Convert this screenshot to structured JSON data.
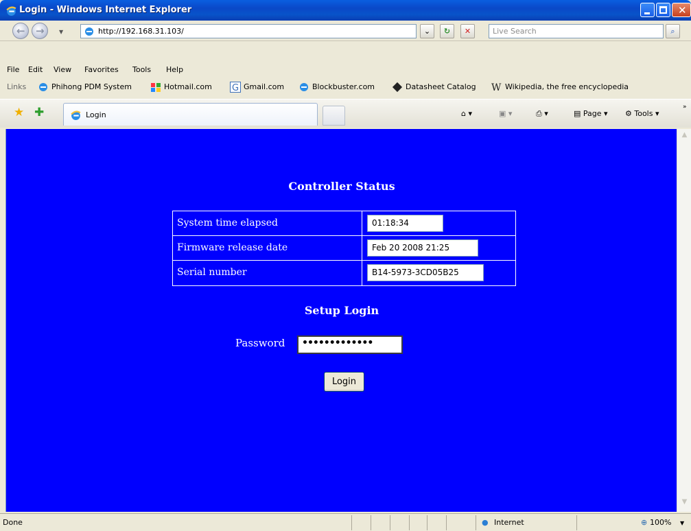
{
  "window": {
    "title": "Login - Windows Internet Explorer"
  },
  "address": {
    "url": "http://192.168.31.103/",
    "search_placeholder": "Live Search"
  },
  "menu": [
    "File",
    "Edit",
    "View",
    "Favorites",
    "Tools",
    "Help"
  ],
  "links_bar": {
    "label": "Links",
    "items": [
      "Phihong PDM System",
      "Hotmail.com",
      "Gmail.com",
      "Blockbuster.com",
      "Datasheet Catalog",
      "Wikipedia, the free encyclopedia"
    ]
  },
  "tab": {
    "title": "Login"
  },
  "commands": {
    "page": "Page",
    "tools": "Tools"
  },
  "page": {
    "status_heading": "Controller Status",
    "rows": [
      {
        "label": "System time elapsed",
        "value": "01:18:34"
      },
      {
        "label": "Firmware release date",
        "value": "Feb 20 2008 21:25"
      },
      {
        "label": "Serial number",
        "value": "B14-5973-3CD05B25"
      }
    ],
    "login_heading": "Setup Login",
    "password_label": "Password",
    "password_mask": "•••••••••••••",
    "login_button": "Login",
    "bg_color": "#0000ff"
  },
  "status_bar": {
    "text": "Done",
    "zone": "Internet",
    "zoom": "100%"
  }
}
